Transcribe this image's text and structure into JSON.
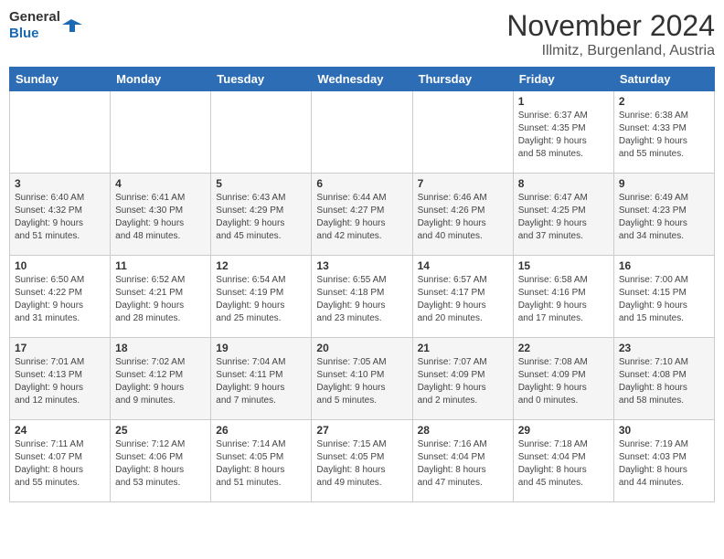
{
  "header": {
    "logo_line1": "General",
    "logo_line2": "Blue",
    "month": "November 2024",
    "location": "Illmitz, Burgenland, Austria"
  },
  "days_of_week": [
    "Sunday",
    "Monday",
    "Tuesday",
    "Wednesday",
    "Thursday",
    "Friday",
    "Saturday"
  ],
  "weeks": [
    [
      {
        "num": "",
        "info": ""
      },
      {
        "num": "",
        "info": ""
      },
      {
        "num": "",
        "info": ""
      },
      {
        "num": "",
        "info": ""
      },
      {
        "num": "",
        "info": ""
      },
      {
        "num": "1",
        "info": "Sunrise: 6:37 AM\nSunset: 4:35 PM\nDaylight: 9 hours\nand 58 minutes."
      },
      {
        "num": "2",
        "info": "Sunrise: 6:38 AM\nSunset: 4:33 PM\nDaylight: 9 hours\nand 55 minutes."
      }
    ],
    [
      {
        "num": "3",
        "info": "Sunrise: 6:40 AM\nSunset: 4:32 PM\nDaylight: 9 hours\nand 51 minutes."
      },
      {
        "num": "4",
        "info": "Sunrise: 6:41 AM\nSunset: 4:30 PM\nDaylight: 9 hours\nand 48 minutes."
      },
      {
        "num": "5",
        "info": "Sunrise: 6:43 AM\nSunset: 4:29 PM\nDaylight: 9 hours\nand 45 minutes."
      },
      {
        "num": "6",
        "info": "Sunrise: 6:44 AM\nSunset: 4:27 PM\nDaylight: 9 hours\nand 42 minutes."
      },
      {
        "num": "7",
        "info": "Sunrise: 6:46 AM\nSunset: 4:26 PM\nDaylight: 9 hours\nand 40 minutes."
      },
      {
        "num": "8",
        "info": "Sunrise: 6:47 AM\nSunset: 4:25 PM\nDaylight: 9 hours\nand 37 minutes."
      },
      {
        "num": "9",
        "info": "Sunrise: 6:49 AM\nSunset: 4:23 PM\nDaylight: 9 hours\nand 34 minutes."
      }
    ],
    [
      {
        "num": "10",
        "info": "Sunrise: 6:50 AM\nSunset: 4:22 PM\nDaylight: 9 hours\nand 31 minutes."
      },
      {
        "num": "11",
        "info": "Sunrise: 6:52 AM\nSunset: 4:21 PM\nDaylight: 9 hours\nand 28 minutes."
      },
      {
        "num": "12",
        "info": "Sunrise: 6:54 AM\nSunset: 4:19 PM\nDaylight: 9 hours\nand 25 minutes."
      },
      {
        "num": "13",
        "info": "Sunrise: 6:55 AM\nSunset: 4:18 PM\nDaylight: 9 hours\nand 23 minutes."
      },
      {
        "num": "14",
        "info": "Sunrise: 6:57 AM\nSunset: 4:17 PM\nDaylight: 9 hours\nand 20 minutes."
      },
      {
        "num": "15",
        "info": "Sunrise: 6:58 AM\nSunset: 4:16 PM\nDaylight: 9 hours\nand 17 minutes."
      },
      {
        "num": "16",
        "info": "Sunrise: 7:00 AM\nSunset: 4:15 PM\nDaylight: 9 hours\nand 15 minutes."
      }
    ],
    [
      {
        "num": "17",
        "info": "Sunrise: 7:01 AM\nSunset: 4:13 PM\nDaylight: 9 hours\nand 12 minutes."
      },
      {
        "num": "18",
        "info": "Sunrise: 7:02 AM\nSunset: 4:12 PM\nDaylight: 9 hours\nand 9 minutes."
      },
      {
        "num": "19",
        "info": "Sunrise: 7:04 AM\nSunset: 4:11 PM\nDaylight: 9 hours\nand 7 minutes."
      },
      {
        "num": "20",
        "info": "Sunrise: 7:05 AM\nSunset: 4:10 PM\nDaylight: 9 hours\nand 5 minutes."
      },
      {
        "num": "21",
        "info": "Sunrise: 7:07 AM\nSunset: 4:09 PM\nDaylight: 9 hours\nand 2 minutes."
      },
      {
        "num": "22",
        "info": "Sunrise: 7:08 AM\nSunset: 4:09 PM\nDaylight: 9 hours\nand 0 minutes."
      },
      {
        "num": "23",
        "info": "Sunrise: 7:10 AM\nSunset: 4:08 PM\nDaylight: 8 hours\nand 58 minutes."
      }
    ],
    [
      {
        "num": "24",
        "info": "Sunrise: 7:11 AM\nSunset: 4:07 PM\nDaylight: 8 hours\nand 55 minutes."
      },
      {
        "num": "25",
        "info": "Sunrise: 7:12 AM\nSunset: 4:06 PM\nDaylight: 8 hours\nand 53 minutes."
      },
      {
        "num": "26",
        "info": "Sunrise: 7:14 AM\nSunset: 4:05 PM\nDaylight: 8 hours\nand 51 minutes."
      },
      {
        "num": "27",
        "info": "Sunrise: 7:15 AM\nSunset: 4:05 PM\nDaylight: 8 hours\nand 49 minutes."
      },
      {
        "num": "28",
        "info": "Sunrise: 7:16 AM\nSunset: 4:04 PM\nDaylight: 8 hours\nand 47 minutes."
      },
      {
        "num": "29",
        "info": "Sunrise: 7:18 AM\nSunset: 4:04 PM\nDaylight: 8 hours\nand 45 minutes."
      },
      {
        "num": "30",
        "info": "Sunrise: 7:19 AM\nSunset: 4:03 PM\nDaylight: 8 hours\nand 44 minutes."
      }
    ]
  ]
}
